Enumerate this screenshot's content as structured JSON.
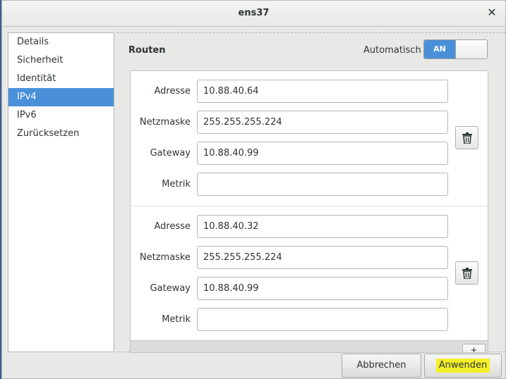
{
  "window": {
    "title": "ens37"
  },
  "sidebar": {
    "items": [
      {
        "label": "Details"
      },
      {
        "label": "Sicherheit"
      },
      {
        "label": "Identität"
      },
      {
        "label": "IPv4"
      },
      {
        "label": "IPv6"
      },
      {
        "label": "Zurücksetzen"
      }
    ],
    "selected": "IPv4"
  },
  "routes": {
    "title": "Routen",
    "automatic_label": "Automatisch",
    "toggle_state": "AN",
    "labels": {
      "address": "Adresse",
      "netmask": "Netzmaske",
      "gateway": "Gateway",
      "metric": "Metrik"
    },
    "entries": [
      {
        "address": "10.88.40.64",
        "netmask": "255.255.255.224",
        "gateway": "10.88.40.99",
        "metric": ""
      },
      {
        "address": "10.88.40.32",
        "netmask": "255.255.255.224",
        "gateway": "10.88.40.99",
        "metric": ""
      }
    ],
    "add_label": "+"
  },
  "buttons": {
    "cancel": "Abbrechen",
    "apply": "Anwenden"
  },
  "colors": {
    "accent": "#4a90d9",
    "highlight": "#f4f028"
  }
}
